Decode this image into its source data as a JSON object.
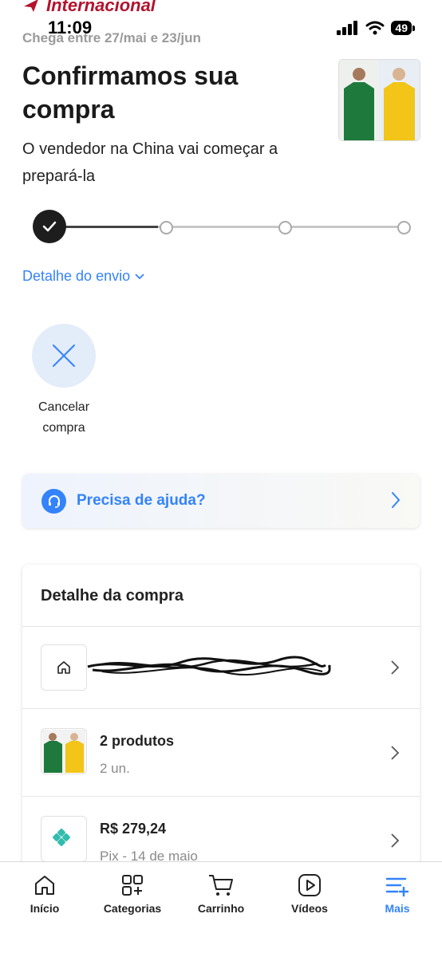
{
  "status_bar": {
    "time": "11:09",
    "battery": "49"
  },
  "header": {
    "brand_label": "Internacional",
    "arrival": "Chega entre 27/mai e 23/jun",
    "title": "Confirmamos sua compra",
    "subtitle": "O vendedor na China vai começar a prepará-la"
  },
  "shipping": {
    "detail_link": "Detalhe do envio"
  },
  "actions": {
    "cancel_label": "Cancelar compra"
  },
  "help": {
    "label": "Precisa de ajuda?"
  },
  "purchase_detail": {
    "title": "Detalhe da compra",
    "products": {
      "title": "2 produtos",
      "quantity": "2 un."
    },
    "payment": {
      "amount": "R$ 279,24",
      "method": "Pix - 14 de maio"
    }
  },
  "bottom_nav": {
    "items": [
      {
        "label": "Início",
        "icon": "home-icon"
      },
      {
        "label": "Categorias",
        "icon": "categories-icon"
      },
      {
        "label": "Carrinho",
        "icon": "cart-icon"
      },
      {
        "label": "Vídeos",
        "icon": "video-icon"
      },
      {
        "label": "Mais",
        "icon": "more-icon",
        "active": true
      }
    ]
  },
  "colors": {
    "accent": "#3483fa",
    "brand_red": "#b3122e",
    "shirt_green": "#1e7a3c",
    "shirt_yellow": "#f2c518",
    "pix_teal": "#32bcad"
  }
}
